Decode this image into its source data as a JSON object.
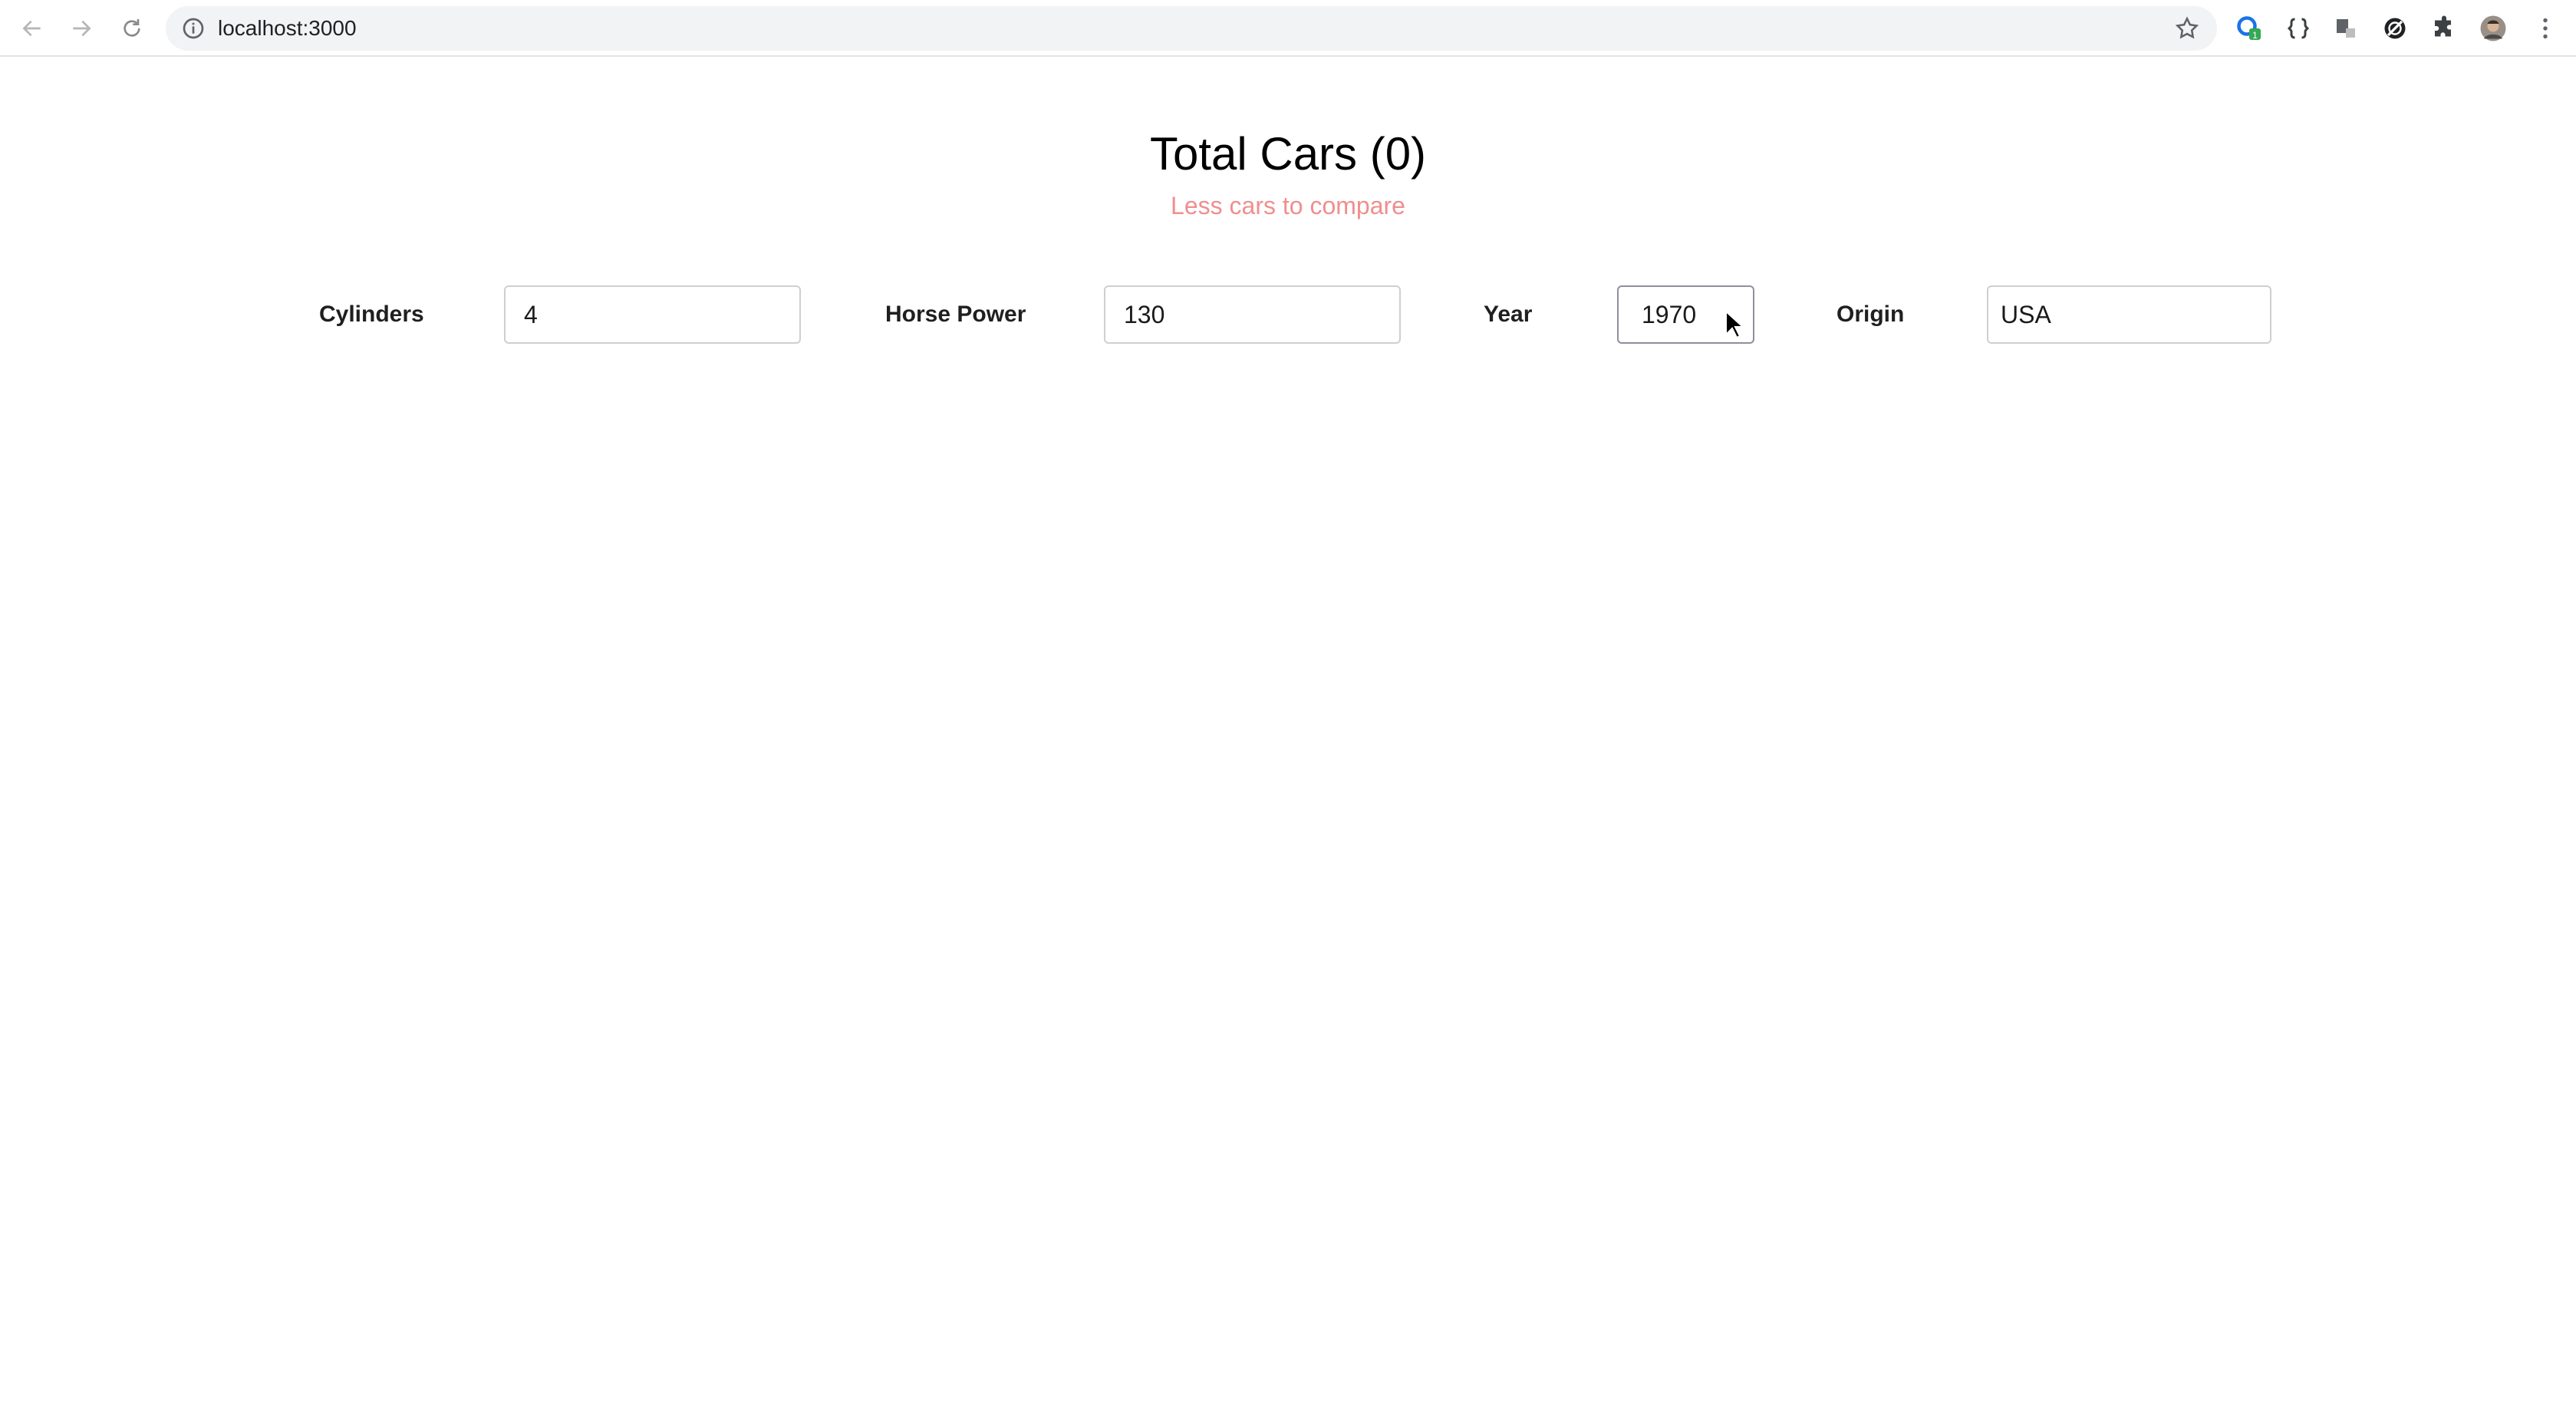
{
  "browser": {
    "url": "localhost:3000",
    "icons": {
      "back": "arrow-left-icon",
      "forward": "arrow-right-icon",
      "reload": "reload-icon",
      "info": "info-icon",
      "bookmark": "star-icon",
      "extensions": [
        "cloud-extension-icon",
        "json-braces-extension-icon",
        "page-extension-icon",
        "blocked-extension-icon",
        "puzzle-piece-icon",
        "profile-avatar",
        "kebab-menu-icon"
      ]
    },
    "extension_badge": "1"
  },
  "page": {
    "title": "Total Cars (0)",
    "subtitle": "Less cars to compare",
    "subtitle_color": "#f08e8e"
  },
  "filters": {
    "cylinders": {
      "label": "Cylinders",
      "value": "4"
    },
    "horse_power": {
      "label": "Horse Power",
      "value": "130"
    },
    "year": {
      "label": "Year",
      "value": "1970"
    },
    "origin": {
      "label": "Origin",
      "value": "USA"
    }
  }
}
